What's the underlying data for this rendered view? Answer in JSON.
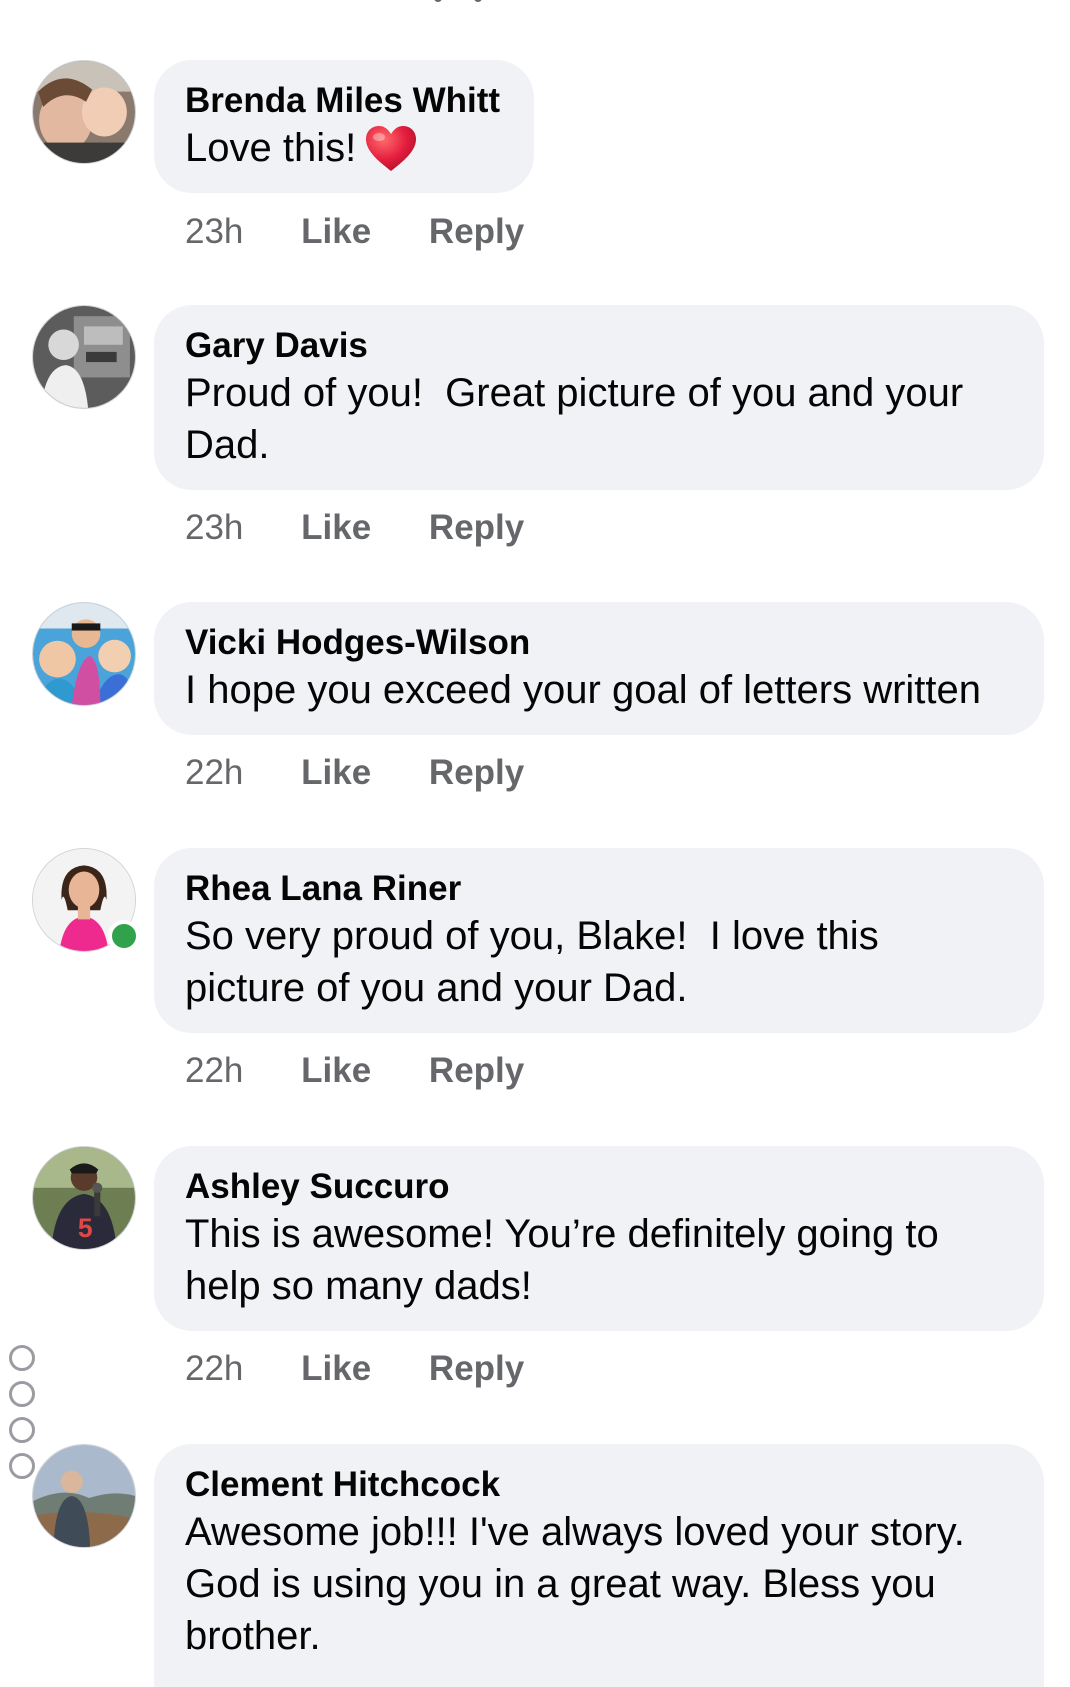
{
  "comments": [
    {
      "author": "Brenda Miles Whitt",
      "text": "Love this!",
      "emoji": "heart-emoji",
      "time": "23h",
      "like": "Like",
      "reply": "Reply"
    },
    {
      "author": "Gary Davis",
      "text": "Proud of you!  Great picture of you and your Dad.",
      "time": "23h",
      "like": "Like",
      "reply": "Reply"
    },
    {
      "author": "Vicki Hodges-Wilson",
      "text": "I hope you exceed your goal of letters written",
      "time": "22h",
      "like": "Like",
      "reply": "Reply"
    },
    {
      "author": "Rhea Lana Riner",
      "text": "So very proud of you, Blake!  I love this picture of you and your Dad.",
      "time": "22h",
      "like": "Like",
      "reply": "Reply",
      "online": true
    },
    {
      "author": "Ashley Succuro",
      "text": "This is awesome! You’re definitely going to help so many dads!",
      "time": "22h",
      "like": "Like",
      "reply": "Reply"
    },
    {
      "author": "Clement Hitchcock",
      "text": "Awesome job!!! I've always loved your story. God is using you in a great way. Bless you brother."
    }
  ],
  "colors": {
    "bubble": "#f0f2f5",
    "meta_text": "#65676b",
    "online": "#31a24c",
    "heart": "#e41e3f"
  }
}
